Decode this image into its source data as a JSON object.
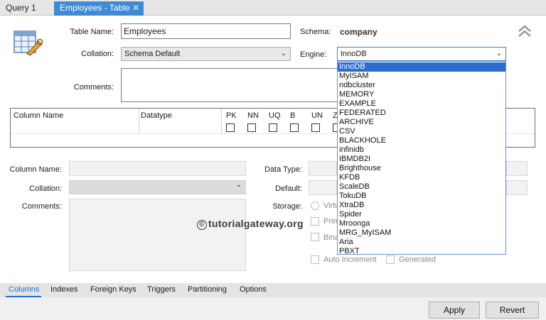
{
  "tabs": [
    {
      "label": "Query 1"
    },
    {
      "label": "Employees - Table",
      "close": "✕"
    }
  ],
  "form": {
    "table_name_label": "Table Name:",
    "table_name_value": "Employees",
    "schema_label": "Schema:",
    "schema_value": "company",
    "collation_label": "Collation:",
    "collation_value": "Schema Default",
    "engine_label": "Engine:",
    "engine_value": "InnoDB",
    "comments_label": "Comments:"
  },
  "grid": {
    "columns": [
      "Column Name",
      "Datatype",
      "PK",
      "NN",
      "UQ",
      "B",
      "UN",
      "Z"
    ]
  },
  "engine_options": [
    "InnoDB",
    "MyISAM",
    "ndbcluster",
    "MEMORY",
    "EXAMPLE",
    "FEDERATED",
    "ARCHIVE",
    "CSV",
    "BLACKHOLE",
    "infinidb",
    "IBMDB2I",
    "Brighthouse",
    "KFDB",
    "ScaleDB",
    "TokuDB",
    "XtraDB",
    "Spider",
    "Mroonga",
    "MRG_MyISAM",
    "Aria",
    "PBXT"
  ],
  "details": {
    "column_name_label": "Column Name:",
    "collation_label": "Collation:",
    "comments_label": "Comments:",
    "data_type_label": "Data Type:",
    "default_label": "Default:",
    "storage_label": "Storage:",
    "virtual_label": "Virtu",
    "primary_label": "Prim",
    "binary_label": "Bina",
    "auto_increment_label": "Auto Increment",
    "generated_label": "Generated"
  },
  "watermark": {
    "symbol": "©",
    "text": "tutorialgateway.org"
  },
  "bottom_tabs": [
    "Columns",
    "Indexes",
    "Foreign Keys",
    "Triggers",
    "Partitioning",
    "Options"
  ],
  "buttons": {
    "apply": "Apply",
    "revert": "Revert"
  },
  "colors": {
    "accent": "#3d8bd4",
    "selection": "#2d6bd1"
  },
  "icons": {
    "table": "table-edit-icon",
    "collapse": "double-chevron-up-icon"
  }
}
